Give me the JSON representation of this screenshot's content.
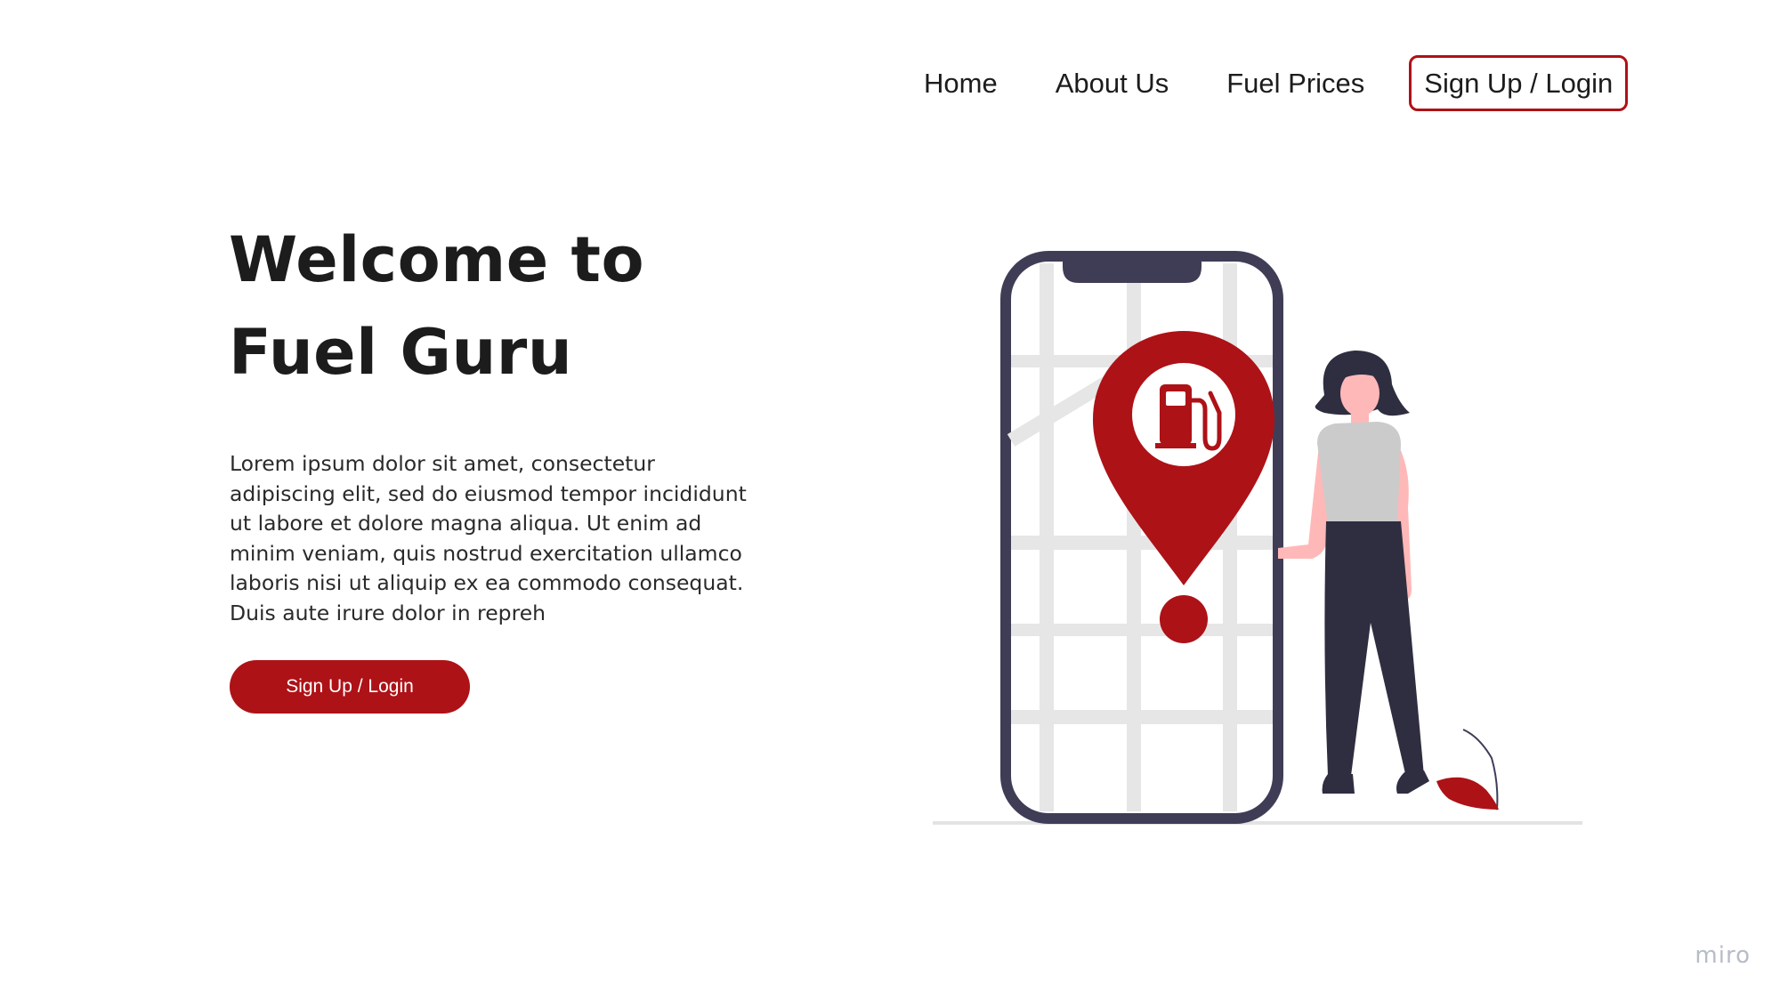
{
  "nav": {
    "items": [
      {
        "label": "Home"
      },
      {
        "label": "About Us"
      },
      {
        "label": "Fuel Prices"
      }
    ],
    "cta_label": "Sign Up / Login"
  },
  "hero": {
    "title_line1": "Welcome to",
    "title_line2": "Fuel Guru",
    "body": "Lorem ipsum dolor sit amet, consectetur adipiscing elit, sed do eiusmod tempor incididunt ut labore et dolore magna aliqua. Ut enim ad minim veniam, quis nostrud exercitation ullamco laboris nisi ut aliquip ex ea commodo consequat. Duis aute irure dolor in repreh",
    "button_label": "Sign Up / Login"
  },
  "illustration": {
    "icons": [
      "smartphone-map-illustration",
      "map-pin-icon",
      "fuel-pump-icon",
      "person-illustration",
      "leaf-icon"
    ]
  },
  "watermark": "miro",
  "colors": {
    "accent": "#ad1217",
    "text": "#1c1c1c",
    "phone_frame": "#3f3d56",
    "map_roads": "#e6e6e6"
  }
}
